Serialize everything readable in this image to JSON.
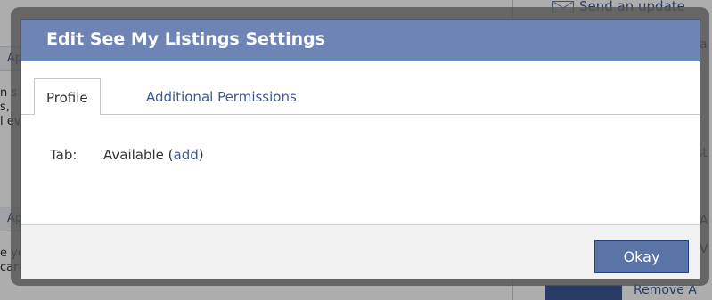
{
  "background": {
    "send_update": "Send an update",
    "section_headers": [
      "Ap",
      "Ap"
    ],
    "body_lines_top": [
      "n s",
      "s,",
      "l ev"
    ],
    "body_lines_bottom": [
      "e yo",
      "car"
    ],
    "right_chars": [
      "a",
      "st",
      "A",
      "V"
    ],
    "remove_link": "Remove A"
  },
  "dialog": {
    "title": "Edit See My Listings Settings",
    "tabs": [
      {
        "label": "Profile",
        "active": true
      },
      {
        "label": "Additional Permissions",
        "active": false
      }
    ],
    "tab_row": {
      "label": "Tab:",
      "value": "Available (",
      "link": "add",
      "suffix": ")"
    },
    "okay_label": "Okay"
  },
  "colors": {
    "title_bar": "#6d84b4",
    "link": "#3b5998",
    "button": "#5b74a8"
  }
}
